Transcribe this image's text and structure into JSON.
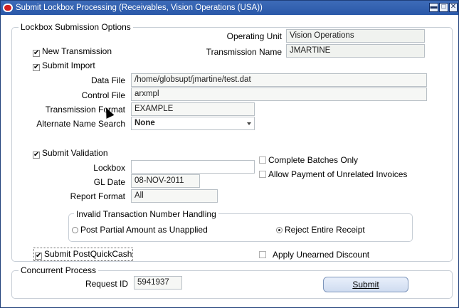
{
  "window": {
    "title": "Submit Lockbox Processing (Receivables, Vision Operations (USA))",
    "minimize_glyph": "▬",
    "maximize_glyph": "□",
    "close_glyph": "✕"
  },
  "options": {
    "legend": "Lockbox Submission Options",
    "operating_unit_label": "Operating Unit",
    "operating_unit_value": "Vision Operations",
    "new_transmission_label": "New Transmission",
    "new_transmission_checked": true,
    "transmission_name_label": "Transmission Name",
    "transmission_name_value": "JMARTINE",
    "submit_import_label": "Submit Import",
    "submit_import_checked": true,
    "data_file_label": "Data File",
    "data_file_value": "/home/globsupt/jmartine/test.dat",
    "control_file_label": "Control File",
    "control_file_value": "arxmpl",
    "transmission_format_label": "Transmission Format",
    "transmission_format_value": "EXAMPLE",
    "alternate_name_search_label": "Alternate Name Search",
    "alternate_name_search_value": "None",
    "submit_validation_label": "Submit Validation",
    "submit_validation_checked": true,
    "lockbox_label": "Lockbox",
    "lockbox_value": "",
    "complete_batches_label": "Complete Batches Only",
    "allow_payment_label": "Allow Payment of Unrelated Invoices",
    "gl_date_label": "GL Date",
    "gl_date_value": "08-NOV-2011",
    "report_format_label": "Report Format",
    "report_format_value": "All",
    "invalid_handling_legend": "Invalid Transaction Number Handling",
    "post_partial_label": "Post Partial Amount as Unapplied",
    "reject_entire_label": "Reject Entire Receipt",
    "selected_handling": "reject",
    "submit_postquickcash_label": "Submit PostQuickCash",
    "apply_unearned_label": "Apply Unearned Discount"
  },
  "concurrent": {
    "legend": "Concurrent Process",
    "request_id_label": "Request ID",
    "request_id_value": "5941937",
    "submit_label": "Submit"
  },
  "check_glyph": "✔",
  "colors": {
    "titlebar": "#2a58a8",
    "field_border": "#b9c0c6",
    "button_border": "#7e96bb"
  }
}
